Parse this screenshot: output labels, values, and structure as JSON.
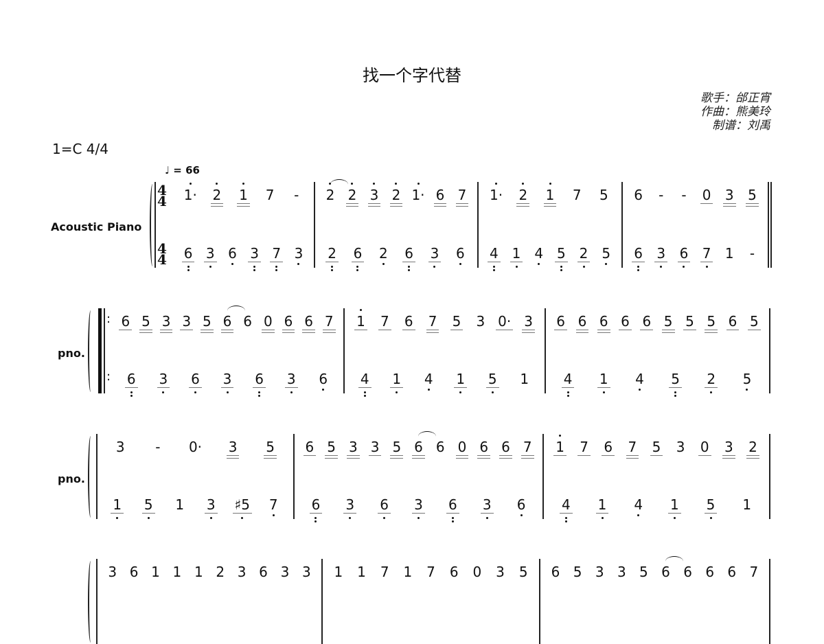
{
  "title": "找一个字代替",
  "credits": [
    "歌手：邰正宵",
    "作曲：熊美玲",
    "制谱：刘禹"
  ],
  "key": "1=C 4/4",
  "tempo": "♩ = 66",
  "time_signature": {
    "top": "4",
    "bottom": "4"
  },
  "systems": [
    {
      "label": "Acoustic Piano",
      "measures": [
        {
          "upper": [
            {
              "t": "1",
              "h": 1,
              "dot": 1
            },
            {
              "t": "2",
              "h": 1,
              "u": 2
            },
            {
              "t": "1",
              "h": 1,
              "u": 2
            },
            {
              "t": "7"
            },
            {
              "t": "-"
            }
          ],
          "lower": [
            {
              "t": "6",
              "u": 1,
              "l": 2
            },
            {
              "t": "3",
              "u": 1,
              "l": 1
            },
            {
              "t": "6",
              "l": 1
            },
            {
              "t": "3",
              "u": 1,
              "l": 2
            },
            {
              "t": "7",
              "u": 1,
              "l": 2
            },
            {
              "t": "3",
              "l": 1
            }
          ]
        },
        {
          "upper": [
            {
              "t": "2",
              "h": 1,
              "tie": 1
            },
            {
              "t": "2",
              "h": 1,
              "u": 2
            },
            {
              "t": "3",
              "h": 1,
              "u": 2
            },
            {
              "t": "2",
              "h": 1,
              "u": 2
            },
            {
              "t": "1",
              "h": 1,
              "dot": 1
            },
            {
              "t": "6",
              "u": 2
            },
            {
              "t": "7",
              "u": 2
            }
          ],
          "lower": [
            {
              "t": "2",
              "u": 1,
              "l": 2
            },
            {
              "t": "6",
              "u": 1,
              "l": 2
            },
            {
              "t": "2",
              "l": 1
            },
            {
              "t": "6",
              "u": 1,
              "l": 2
            },
            {
              "t": "3",
              "u": 1,
              "l": 1
            },
            {
              "t": "6",
              "l": 1
            }
          ]
        },
        {
          "upper": [
            {
              "t": "1",
              "h": 1,
              "dot": 1
            },
            {
              "t": "2",
              "h": 1,
              "u": 2
            },
            {
              "t": "1",
              "h": 1,
              "u": 2
            },
            {
              "t": "7"
            },
            {
              "t": "5"
            }
          ],
          "lower": [
            {
              "t": "4",
              "u": 1,
              "l": 2
            },
            {
              "t": "1",
              "u": 1,
              "l": 1
            },
            {
              "t": "4",
              "l": 1
            },
            {
              "t": "5",
              "u": 1,
              "l": 2
            },
            {
              "t": "2",
              "u": 1,
              "l": 1
            },
            {
              "t": "5",
              "l": 1
            }
          ]
        },
        {
          "upper": [
            {
              "t": "6"
            },
            {
              "t": "-"
            },
            {
              "t": "-"
            },
            {
              "t": "0",
              "u": 1
            },
            {
              "t": "3",
              "u": 2
            },
            {
              "t": "5",
              "u": 2
            }
          ],
          "lower": [
            {
              "t": "6",
              "u": 1,
              "l": 2
            },
            {
              "t": "3",
              "u": 1,
              "l": 1
            },
            {
              "t": "6",
              "u": 1,
              "l": 1
            },
            {
              "t": "7",
              "u": 1,
              "l": 1
            },
            {
              "t": "1"
            },
            {
              "t": "-"
            }
          ]
        }
      ]
    },
    {
      "label": "pno.",
      "measures": [
        {
          "upper": [
            {
              "t": "6",
              "u": 1
            },
            {
              "t": "5",
              "u": 2
            },
            {
              "t": "3",
              "u": 2
            },
            {
              "t": "3",
              "u": 1
            },
            {
              "t": "5",
              "u": 2
            },
            {
              "t": "6",
              "u": 2,
              "tie": 1
            },
            {
              "t": "6"
            },
            {
              "t": "0",
              "u": 2
            },
            {
              "t": "6",
              "u": 2
            },
            {
              "t": "6",
              "u": 2
            },
            {
              "t": "7",
              "u": 2
            }
          ],
          "lower": [
            {
              "t": "6",
              "u": 1,
              "l": 2
            },
            {
              "t": "3",
              "u": 1,
              "l": 1
            },
            {
              "t": "6",
              "u": 1,
              "l": 1
            },
            {
              "t": "3",
              "u": 1,
              "l": 1
            },
            {
              "t": "6",
              "u": 1,
              "l": 2
            },
            {
              "t": "3",
              "u": 1,
              "l": 1
            },
            {
              "t": "6",
              "l": 1
            }
          ]
        },
        {
          "upper": [
            {
              "t": "1",
              "h": 1,
              "u": 1
            },
            {
              "t": "7",
              "u": 1
            },
            {
              "t": "6",
              "u": 1
            },
            {
              "t": "7",
              "u": 2
            },
            {
              "t": "5",
              "u": 1
            },
            {
              "t": "3"
            },
            {
              "t": "0",
              "u": 1,
              "dot": 1
            },
            {
              "t": "3",
              "u": 2
            }
          ],
          "lower": [
            {
              "t": "4",
              "u": 1,
              "l": 2
            },
            {
              "t": "1",
              "u": 1,
              "l": 1
            },
            {
              "t": "4",
              "l": 1
            },
            {
              "t": "1",
              "u": 1,
              "l": 1
            },
            {
              "t": "5",
              "u": 1,
              "l": 1
            },
            {
              "t": "1"
            }
          ]
        },
        {
          "upper": [
            {
              "t": "6",
              "u": 1
            },
            {
              "t": "6",
              "u": 2
            },
            {
              "t": "6",
              "u": 2
            },
            {
              "t": "6",
              "u": 1
            },
            {
              "t": "6",
              "u": 1
            },
            {
              "t": "5",
              "u": 2
            },
            {
              "t": "5",
              "u": 1
            },
            {
              "t": "5",
              "u": 2
            },
            {
              "t": "6",
              "u": 1
            },
            {
              "t": "5",
              "u": 1
            }
          ],
          "lower": [
            {
              "t": "4",
              "u": 1,
              "l": 2
            },
            {
              "t": "1",
              "u": 1,
              "l": 1
            },
            {
              "t": "4",
              "l": 1
            },
            {
              "t": "5",
              "u": 1,
              "l": 2
            },
            {
              "t": "2",
              "u": 1,
              "l": 1
            },
            {
              "t": "5",
              "l": 1
            }
          ]
        }
      ]
    },
    {
      "label": "pno.",
      "measures": [
        {
          "upper": [
            {
              "t": "3"
            },
            {
              "t": "-"
            },
            {
              "t": "0",
              "dot": 1
            },
            {
              "t": "3",
              "u": 2
            },
            {
              "t": "5",
              "u": 2
            }
          ],
          "lower": [
            {
              "t": "1",
              "u": 1,
              "l": 1
            },
            {
              "t": "5",
              "u": 1,
              "l": 1
            },
            {
              "t": "1"
            },
            {
              "t": "3",
              "u": 1,
              "l": 1
            },
            {
              "t": "♯5",
              "u": 1,
              "l": 1
            },
            {
              "t": "7",
              "l": 1
            }
          ]
        },
        {
          "upper": [
            {
              "t": "6",
              "u": 1
            },
            {
              "t": "5",
              "u": 2
            },
            {
              "t": "3",
              "u": 2
            },
            {
              "t": "3",
              "u": 1
            },
            {
              "t": "5",
              "u": 2
            },
            {
              "t": "6",
              "u": 2,
              "tie": 1
            },
            {
              "t": "6"
            },
            {
              "t": "0",
              "u": 2
            },
            {
              "t": "6",
              "u": 2
            },
            {
              "t": "6",
              "u": 2
            },
            {
              "t": "7",
              "u": 2
            }
          ],
          "lower": [
            {
              "t": "6",
              "u": 1,
              "l": 2
            },
            {
              "t": "3",
              "u": 1,
              "l": 1
            },
            {
              "t": "6",
              "u": 1,
              "l": 1
            },
            {
              "t": "3",
              "u": 1,
              "l": 1
            },
            {
              "t": "6",
              "u": 1,
              "l": 2
            },
            {
              "t": "3",
              "u": 1,
              "l": 1
            },
            {
              "t": "6",
              "l": 1
            }
          ]
        },
        {
          "upper": [
            {
              "t": "1",
              "h": 1,
              "u": 1
            },
            {
              "t": "7",
              "u": 1
            },
            {
              "t": "6",
              "u": 1
            },
            {
              "t": "7",
              "u": 2
            },
            {
              "t": "5",
              "u": 1
            },
            {
              "t": "3"
            },
            {
              "t": "0",
              "u": 1
            },
            {
              "t": "3",
              "u": 2
            },
            {
              "t": "2",
              "u": 2
            }
          ],
          "lower": [
            {
              "t": "4",
              "u": 1,
              "l": 2
            },
            {
              "t": "1",
              "u": 1,
              "l": 1
            },
            {
              "t": "4",
              "l": 1
            },
            {
              "t": "1",
              "u": 1,
              "l": 1
            },
            {
              "t": "5",
              "u": 1,
              "l": 1
            },
            {
              "t": "1"
            }
          ]
        }
      ]
    },
    {
      "label": "",
      "measures": [
        {
          "upper": [
            {
              "t": "3"
            },
            {
              "t": "6"
            },
            {
              "t": "1"
            },
            {
              "t": "1"
            },
            {
              "t": "1"
            },
            {
              "t": "2"
            },
            {
              "t": "3"
            },
            {
              "t": "6"
            },
            {
              "t": "3"
            },
            {
              "t": "3"
            }
          ],
          "lower": []
        },
        {
          "upper": [
            {
              "t": "1"
            },
            {
              "t": "1"
            },
            {
              "t": "7"
            },
            {
              "t": "1"
            },
            {
              "t": "7"
            },
            {
              "t": "6"
            },
            {
              "t": "0"
            },
            {
              "t": "3"
            },
            {
              "t": "5"
            }
          ],
          "lower": []
        },
        {
          "upper": [
            {
              "t": "6"
            },
            {
              "t": "5"
            },
            {
              "t": "3"
            },
            {
              "t": "3"
            },
            {
              "t": "5"
            },
            {
              "t": "6",
              "tie": 1
            },
            {
              "t": "6"
            },
            {
              "t": "6"
            },
            {
              "t": "6"
            },
            {
              "t": "7"
            }
          ],
          "lower": []
        }
      ]
    }
  ]
}
